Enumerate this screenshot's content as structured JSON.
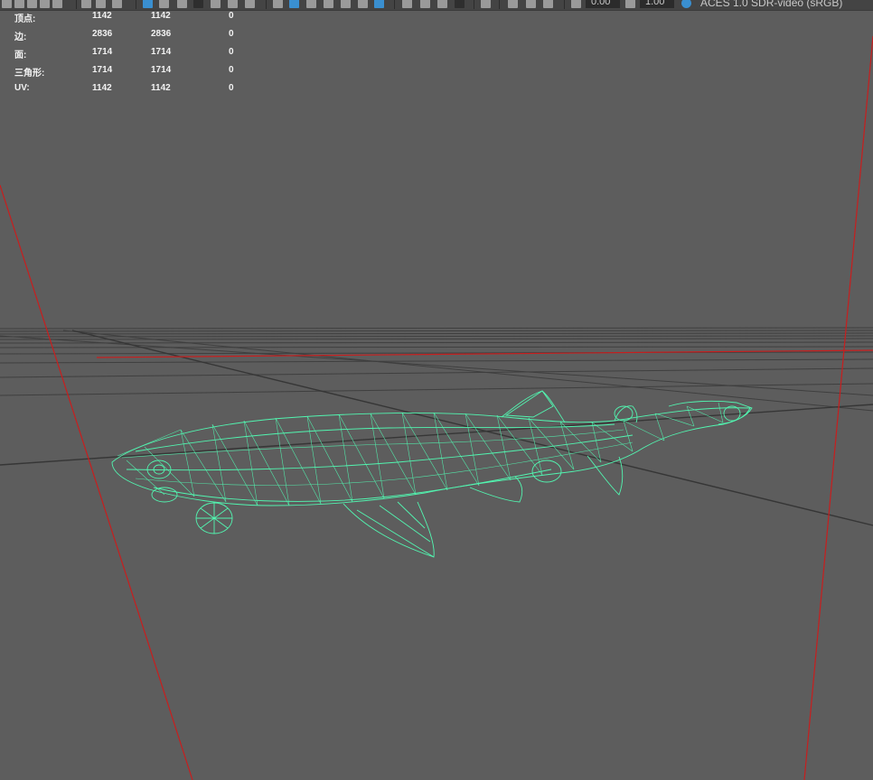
{
  "toolbar": {
    "exposure_value": "0.00",
    "gamma_value": "1.00",
    "color_space_label": "ACES 1.0 SDR-video (sRGB)",
    "icons": [
      "camera-icon",
      "camera-attributes-icon",
      "bookmark-icon",
      "image-plane-icon",
      "grid-icon",
      "film-gate-icon",
      "resolution-gate-icon",
      "gate-mask-icon",
      "field-chart-icon",
      "safe-action-icon",
      "safe-title-icon",
      "wireframe-icon",
      "smooth-shade-icon",
      "default-material-icon",
      "textured-icon",
      "use-all-lights-icon",
      "shadows-icon",
      "screen-space-ao-icon",
      "motion-blur-icon",
      "anti-aliasing-icon",
      "depth-of-field-icon",
      "isolate-select-icon",
      "xray-icon",
      "xray-joints-icon",
      "backface-culling-icon",
      "exposure-icon",
      "gamma-icon",
      "color-management-icon"
    ]
  },
  "hud": {
    "rows": [
      {
        "label": "顶点:",
        "v1": "1142",
        "v2": "1142",
        "v3": "0"
      },
      {
        "label": "边:",
        "v1": "2836",
        "v2": "2836",
        "v3": "0"
      },
      {
        "label": "面:",
        "v1": "1714",
        "v2": "1714",
        "v3": "0"
      },
      {
        "label": "三角形:",
        "v1": "1714",
        "v2": "1714",
        "v3": "0"
      },
      {
        "label": "UV:",
        "v1": "1142",
        "v2": "1142",
        "v3": "0"
      }
    ]
  },
  "scene": {
    "background_color": "#5d5d5d",
    "wireframe_color": "#52f5b0",
    "axis_color": "#c81e1e",
    "grid_color": "#3e3e3e",
    "object": "shark wireframe mesh"
  }
}
